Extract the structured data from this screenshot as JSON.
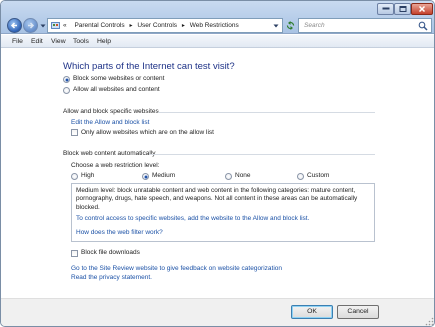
{
  "address_bar": {
    "breadcrumbs": [
      "Parental Controls",
      "User Controls",
      "Web Restrictions"
    ],
    "overflow_marker": "«"
  },
  "search": {
    "placeholder": "Search"
  },
  "menu": [
    "File",
    "Edit",
    "View",
    "Tools",
    "Help"
  ],
  "main": {
    "heading": "Which parts of the Internet can test visit?",
    "scope_options": [
      {
        "label": "Block some websites or content",
        "checked": true
      },
      {
        "label": "Allow all websites and content",
        "checked": false
      }
    ],
    "allow_block_section": {
      "title": "Allow and block specific websites",
      "edit_link": "Edit the Allow and block list",
      "only_allow_checkbox": {
        "label": "Only allow websites which are on the allow list",
        "checked": false
      }
    },
    "web_content_section": {
      "title": "Block web content automatically",
      "choose_label": "Choose a web restriction level:",
      "levels": [
        {
          "label": "High",
          "checked": false
        },
        {
          "label": "Medium",
          "checked": true
        },
        {
          "label": "None",
          "checked": false
        },
        {
          "label": "Custom",
          "checked": false
        }
      ],
      "description": "Medium level: block unratable content and web content in the following categories: mature content, pornography, drugs, hate speech, and weapons. Not all content in these areas can be automatically blocked.",
      "control_link": "To control access to specific websites, add the website to the Allow and block list.",
      "how_link": "How does the web filter work?"
    },
    "block_downloads_checkbox": {
      "label": "Block file downloads",
      "checked": false
    },
    "site_review_link": "Go to the Site Review website to give feedback on website categorization",
    "privacy_link": "Read the privacy statement."
  },
  "buttons": {
    "ok": "OK",
    "cancel": "Cancel"
  },
  "colors": {
    "heading": "#1e3287",
    "link": "#1b51a6",
    "titlebar": "#b9cfea"
  }
}
